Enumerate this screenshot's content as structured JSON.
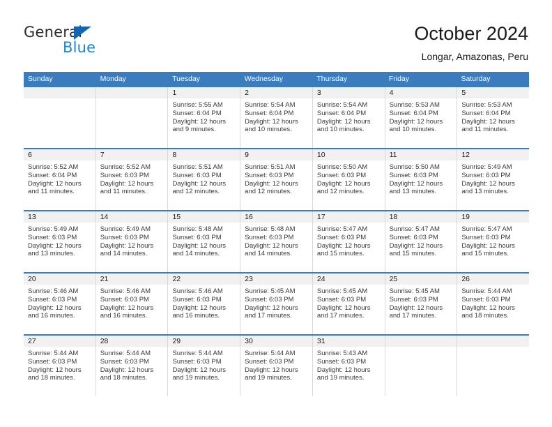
{
  "brand": {
    "name_part1": "General",
    "name_part2": "Blue",
    "accent_color": "#1b84d6",
    "triangle_color": "#1466b0"
  },
  "header": {
    "title": "October 2024",
    "subtitle": "Longar, Amazonas, Peru"
  },
  "calendar": {
    "header_bg": "#3a7cbe",
    "daynum_bg": "#f1f1f1",
    "weekday_headers": [
      "Sunday",
      "Monday",
      "Tuesday",
      "Wednesday",
      "Thursday",
      "Friday",
      "Saturday"
    ],
    "weeks": [
      [
        {
          "day": "",
          "sunrise": "",
          "sunset": "",
          "daylight_line1": "",
          "daylight_line2": ""
        },
        {
          "day": "",
          "sunrise": "",
          "sunset": "",
          "daylight_line1": "",
          "daylight_line2": ""
        },
        {
          "day": "1",
          "sunrise": "Sunrise: 5:55 AM",
          "sunset": "Sunset: 6:04 PM",
          "daylight_line1": "Daylight: 12 hours",
          "daylight_line2": "and 9 minutes."
        },
        {
          "day": "2",
          "sunrise": "Sunrise: 5:54 AM",
          "sunset": "Sunset: 6:04 PM",
          "daylight_line1": "Daylight: 12 hours",
          "daylight_line2": "and 10 minutes."
        },
        {
          "day": "3",
          "sunrise": "Sunrise: 5:54 AM",
          "sunset": "Sunset: 6:04 PM",
          "daylight_line1": "Daylight: 12 hours",
          "daylight_line2": "and 10 minutes."
        },
        {
          "day": "4",
          "sunrise": "Sunrise: 5:53 AM",
          "sunset": "Sunset: 6:04 PM",
          "daylight_line1": "Daylight: 12 hours",
          "daylight_line2": "and 10 minutes."
        },
        {
          "day": "5",
          "sunrise": "Sunrise: 5:53 AM",
          "sunset": "Sunset: 6:04 PM",
          "daylight_line1": "Daylight: 12 hours",
          "daylight_line2": "and 11 minutes."
        }
      ],
      [
        {
          "day": "6",
          "sunrise": "Sunrise: 5:52 AM",
          "sunset": "Sunset: 6:04 PM",
          "daylight_line1": "Daylight: 12 hours",
          "daylight_line2": "and 11 minutes."
        },
        {
          "day": "7",
          "sunrise": "Sunrise: 5:52 AM",
          "sunset": "Sunset: 6:03 PM",
          "daylight_line1": "Daylight: 12 hours",
          "daylight_line2": "and 11 minutes."
        },
        {
          "day": "8",
          "sunrise": "Sunrise: 5:51 AM",
          "sunset": "Sunset: 6:03 PM",
          "daylight_line1": "Daylight: 12 hours",
          "daylight_line2": "and 12 minutes."
        },
        {
          "day": "9",
          "sunrise": "Sunrise: 5:51 AM",
          "sunset": "Sunset: 6:03 PM",
          "daylight_line1": "Daylight: 12 hours",
          "daylight_line2": "and 12 minutes."
        },
        {
          "day": "10",
          "sunrise": "Sunrise: 5:50 AM",
          "sunset": "Sunset: 6:03 PM",
          "daylight_line1": "Daylight: 12 hours",
          "daylight_line2": "and 12 minutes."
        },
        {
          "day": "11",
          "sunrise": "Sunrise: 5:50 AM",
          "sunset": "Sunset: 6:03 PM",
          "daylight_line1": "Daylight: 12 hours",
          "daylight_line2": "and 13 minutes."
        },
        {
          "day": "12",
          "sunrise": "Sunrise: 5:49 AM",
          "sunset": "Sunset: 6:03 PM",
          "daylight_line1": "Daylight: 12 hours",
          "daylight_line2": "and 13 minutes."
        }
      ],
      [
        {
          "day": "13",
          "sunrise": "Sunrise: 5:49 AM",
          "sunset": "Sunset: 6:03 PM",
          "daylight_line1": "Daylight: 12 hours",
          "daylight_line2": "and 13 minutes."
        },
        {
          "day": "14",
          "sunrise": "Sunrise: 5:49 AM",
          "sunset": "Sunset: 6:03 PM",
          "daylight_line1": "Daylight: 12 hours",
          "daylight_line2": "and 14 minutes."
        },
        {
          "day": "15",
          "sunrise": "Sunrise: 5:48 AM",
          "sunset": "Sunset: 6:03 PM",
          "daylight_line1": "Daylight: 12 hours",
          "daylight_line2": "and 14 minutes."
        },
        {
          "day": "16",
          "sunrise": "Sunrise: 5:48 AM",
          "sunset": "Sunset: 6:03 PM",
          "daylight_line1": "Daylight: 12 hours",
          "daylight_line2": "and 14 minutes."
        },
        {
          "day": "17",
          "sunrise": "Sunrise: 5:47 AM",
          "sunset": "Sunset: 6:03 PM",
          "daylight_line1": "Daylight: 12 hours",
          "daylight_line2": "and 15 minutes."
        },
        {
          "day": "18",
          "sunrise": "Sunrise: 5:47 AM",
          "sunset": "Sunset: 6:03 PM",
          "daylight_line1": "Daylight: 12 hours",
          "daylight_line2": "and 15 minutes."
        },
        {
          "day": "19",
          "sunrise": "Sunrise: 5:47 AM",
          "sunset": "Sunset: 6:03 PM",
          "daylight_line1": "Daylight: 12 hours",
          "daylight_line2": "and 15 minutes."
        }
      ],
      [
        {
          "day": "20",
          "sunrise": "Sunrise: 5:46 AM",
          "sunset": "Sunset: 6:03 PM",
          "daylight_line1": "Daylight: 12 hours",
          "daylight_line2": "and 16 minutes."
        },
        {
          "day": "21",
          "sunrise": "Sunrise: 5:46 AM",
          "sunset": "Sunset: 6:03 PM",
          "daylight_line1": "Daylight: 12 hours",
          "daylight_line2": "and 16 minutes."
        },
        {
          "day": "22",
          "sunrise": "Sunrise: 5:46 AM",
          "sunset": "Sunset: 6:03 PM",
          "daylight_line1": "Daylight: 12 hours",
          "daylight_line2": "and 16 minutes."
        },
        {
          "day": "23",
          "sunrise": "Sunrise: 5:45 AM",
          "sunset": "Sunset: 6:03 PM",
          "daylight_line1": "Daylight: 12 hours",
          "daylight_line2": "and 17 minutes."
        },
        {
          "day": "24",
          "sunrise": "Sunrise: 5:45 AM",
          "sunset": "Sunset: 6:03 PM",
          "daylight_line1": "Daylight: 12 hours",
          "daylight_line2": "and 17 minutes."
        },
        {
          "day": "25",
          "sunrise": "Sunrise: 5:45 AM",
          "sunset": "Sunset: 6:03 PM",
          "daylight_line1": "Daylight: 12 hours",
          "daylight_line2": "and 17 minutes."
        },
        {
          "day": "26",
          "sunrise": "Sunrise: 5:44 AM",
          "sunset": "Sunset: 6:03 PM",
          "daylight_line1": "Daylight: 12 hours",
          "daylight_line2": "and 18 minutes."
        }
      ],
      [
        {
          "day": "27",
          "sunrise": "Sunrise: 5:44 AM",
          "sunset": "Sunset: 6:03 PM",
          "daylight_line1": "Daylight: 12 hours",
          "daylight_line2": "and 18 minutes."
        },
        {
          "day": "28",
          "sunrise": "Sunrise: 5:44 AM",
          "sunset": "Sunset: 6:03 PM",
          "daylight_line1": "Daylight: 12 hours",
          "daylight_line2": "and 18 minutes."
        },
        {
          "day": "29",
          "sunrise": "Sunrise: 5:44 AM",
          "sunset": "Sunset: 6:03 PM",
          "daylight_line1": "Daylight: 12 hours",
          "daylight_line2": "and 19 minutes."
        },
        {
          "day": "30",
          "sunrise": "Sunrise: 5:44 AM",
          "sunset": "Sunset: 6:03 PM",
          "daylight_line1": "Daylight: 12 hours",
          "daylight_line2": "and 19 minutes."
        },
        {
          "day": "31",
          "sunrise": "Sunrise: 5:43 AM",
          "sunset": "Sunset: 6:03 PM",
          "daylight_line1": "Daylight: 12 hours",
          "daylight_line2": "and 19 minutes."
        },
        {
          "day": "",
          "sunrise": "",
          "sunset": "",
          "daylight_line1": "",
          "daylight_line2": ""
        },
        {
          "day": "",
          "sunrise": "",
          "sunset": "",
          "daylight_line1": "",
          "daylight_line2": ""
        }
      ]
    ]
  }
}
